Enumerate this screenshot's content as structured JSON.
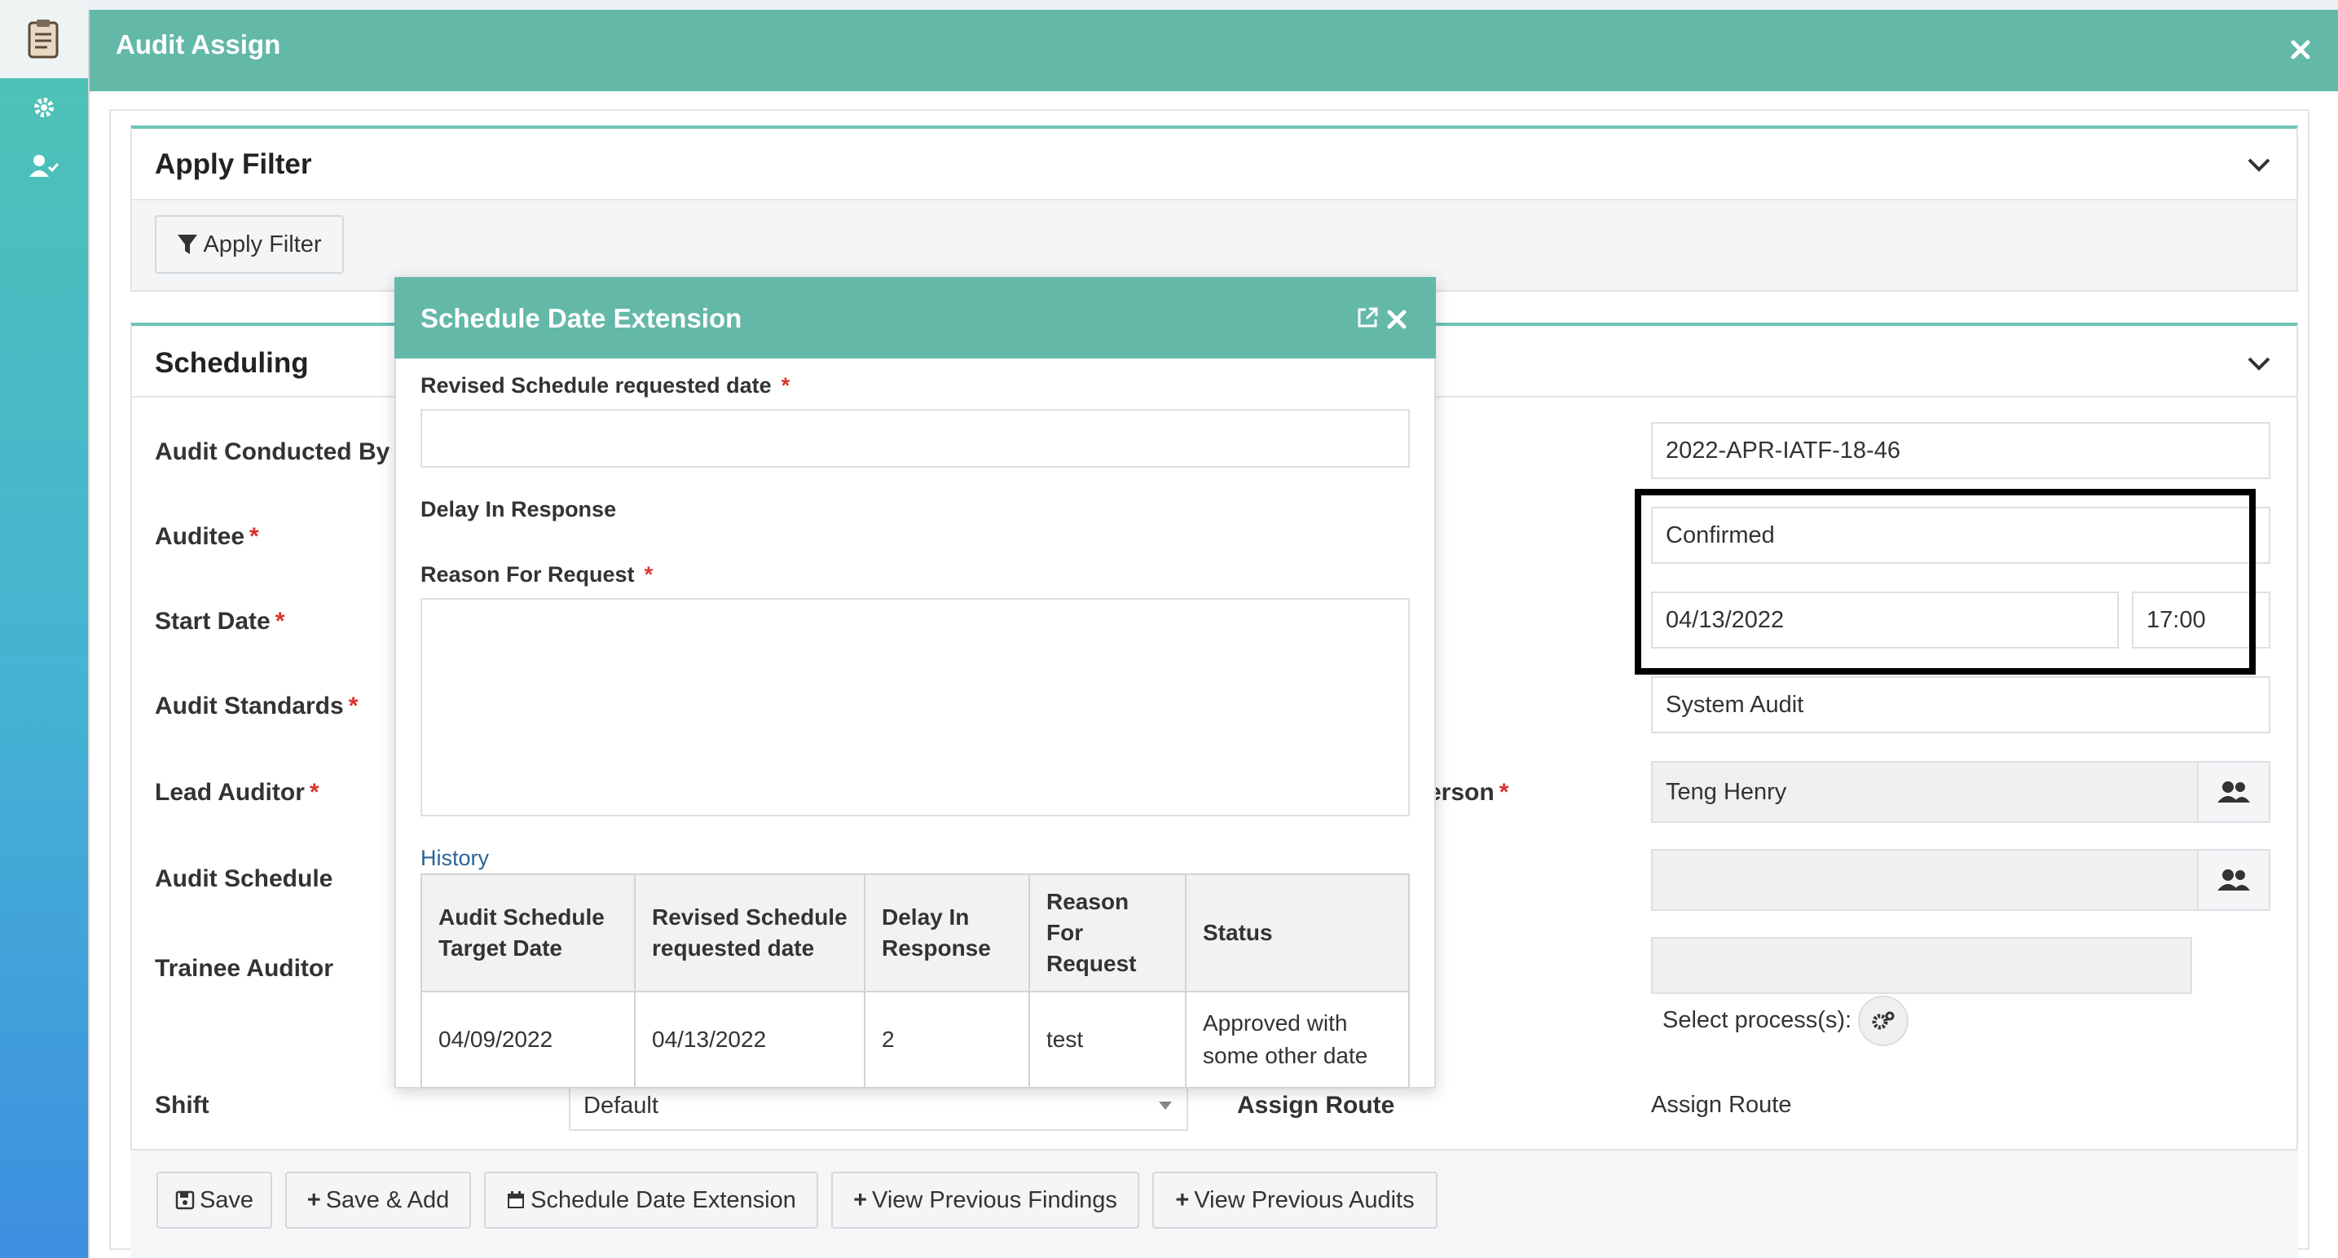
{
  "window": {
    "title": "Audit Assign"
  },
  "filter_panel": {
    "title": "Apply Filter",
    "button_label": "Apply Filter"
  },
  "scheduling": {
    "title": "Scheduling",
    "labels": {
      "conducted_by": "Audit Conducted By",
      "auditee": "Auditee",
      "start_date": "Start Date",
      "standards": "Audit Standards",
      "lead_auditor": "Lead Auditor",
      "audit_schedule": "Audit Schedule",
      "trainee": "Trainee Auditor",
      "shift": "Shift",
      "person_partial": "erson",
      "assign_route": "Assign Route"
    },
    "values": {
      "audit_id": "2022-APR-IATF-18-46",
      "status": "Confirmed",
      "date": "04/13/2022",
      "time": "17:00",
      "audit_type": "System Audit",
      "person": "Teng Henry",
      "select_process": "Select process(s):",
      "shift": "Default",
      "assign_route_value": "Assign Route"
    }
  },
  "modal": {
    "title": "Schedule Date Extension",
    "revised_label": "Revised Schedule requested date",
    "revised_value": "",
    "delay_label": "Delay In Response",
    "reason_label": "Reason For Request",
    "reason_value": "",
    "history_label": "History",
    "history_headers": [
      "Audit Schedule Target Date",
      "Revised Schedule requested date",
      "Delay In Response",
      "Reason For Request",
      "Status"
    ],
    "history_rows": [
      [
        "04/09/2022",
        "04/13/2022",
        "2",
        "test",
        "Approved with some other date"
      ]
    ]
  },
  "footer": {
    "save": "Save",
    "save_add": "Save & Add",
    "schedule_ext": "Schedule Date Extension",
    "view_findings": "View Previous Findings",
    "view_audits": "View Previous Audits"
  },
  "colors": {
    "header": "#63b8a8",
    "required": "#d9342b",
    "link": "#2a6496"
  }
}
